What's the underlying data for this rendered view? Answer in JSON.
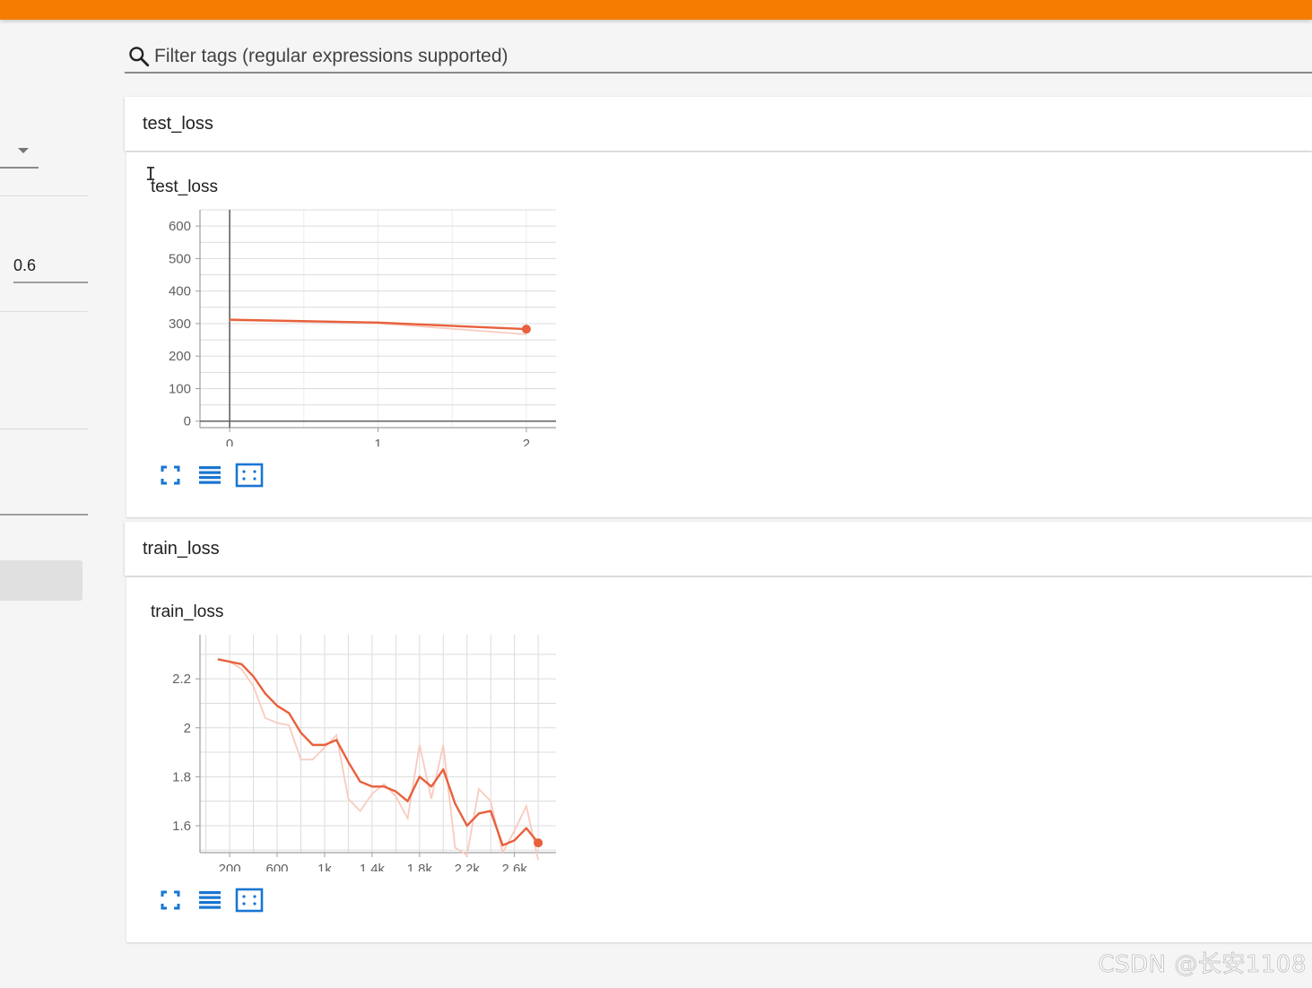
{
  "sidebar": {
    "smoothing_value": "0.6"
  },
  "filter": {
    "placeholder": "Filter tags (regular expressions supported)",
    "icon": "search-icon"
  },
  "panes": [
    {
      "header": "test_loss",
      "card_title": "test_loss"
    },
    {
      "header": "train_loss",
      "card_title": "train_loss"
    }
  ],
  "toolbar_icons": [
    "fullscreen-icon",
    "data-table-icon",
    "fit-domain-icon"
  ],
  "accent_color": "#f57c00",
  "series_color": "#e8603c",
  "raw_series_color": "#f8cbbf",
  "watermark": "CSDN @长安1108",
  "chart_data": [
    {
      "type": "line",
      "title": "test_loss",
      "x": [
        0,
        1,
        2
      ],
      "series": [
        {
          "values": [
            312,
            303,
            283
          ],
          "style": "smoothed"
        },
        {
          "values": [
            310,
            301,
            267
          ],
          "style": "raw"
        }
      ],
      "x_ticks": [
        "0",
        "1",
        "2"
      ],
      "y_ticks": [
        "0",
        "100",
        "200",
        "300",
        "400",
        "500",
        "600"
      ],
      "xlim": [
        -0.2,
        2.2
      ],
      "ylim": [
        -20,
        650
      ],
      "grid": true,
      "legend": "none"
    },
    {
      "type": "line",
      "title": "train_loss",
      "x": [
        100,
        200,
        300,
        400,
        500,
        600,
        700,
        800,
        900,
        1000,
        1100,
        1200,
        1300,
        1400,
        1500,
        1600,
        1700,
        1800,
        1900,
        2000,
        2100,
        2200,
        2300,
        2400,
        2500,
        2600,
        2700,
        2800
      ],
      "series": [
        {
          "values": [
            2.28,
            2.27,
            2.26,
            2.21,
            2.14,
            2.09,
            2.06,
            1.98,
            1.93,
            1.93,
            1.95,
            1.86,
            1.78,
            1.76,
            1.76,
            1.74,
            1.7,
            1.8,
            1.76,
            1.83,
            1.69,
            1.6,
            1.65,
            1.66,
            1.52,
            1.54,
            1.59,
            1.53
          ],
          "style": "smoothed"
        },
        {
          "values": [
            2.28,
            2.27,
            2.24,
            2.17,
            2.04,
            2.02,
            2.01,
            1.87,
            1.87,
            1.92,
            1.97,
            1.71,
            1.66,
            1.73,
            1.77,
            1.72,
            1.63,
            1.93,
            1.71,
            1.93,
            1.51,
            1.48,
            1.75,
            1.7,
            1.49,
            1.58,
            1.68,
            1.46
          ],
          "style": "raw"
        }
      ],
      "x_ticks": [
        "200",
        "600",
        "1k",
        "1.4k",
        "1.8k",
        "2.2k",
        "2.6k"
      ],
      "y_ticks": [
        "1.6",
        "1.8",
        "2",
        "2.2"
      ],
      "xlim": [
        -50,
        2950
      ],
      "ylim": [
        1.49,
        2.38
      ],
      "grid": true,
      "legend": "none"
    }
  ]
}
